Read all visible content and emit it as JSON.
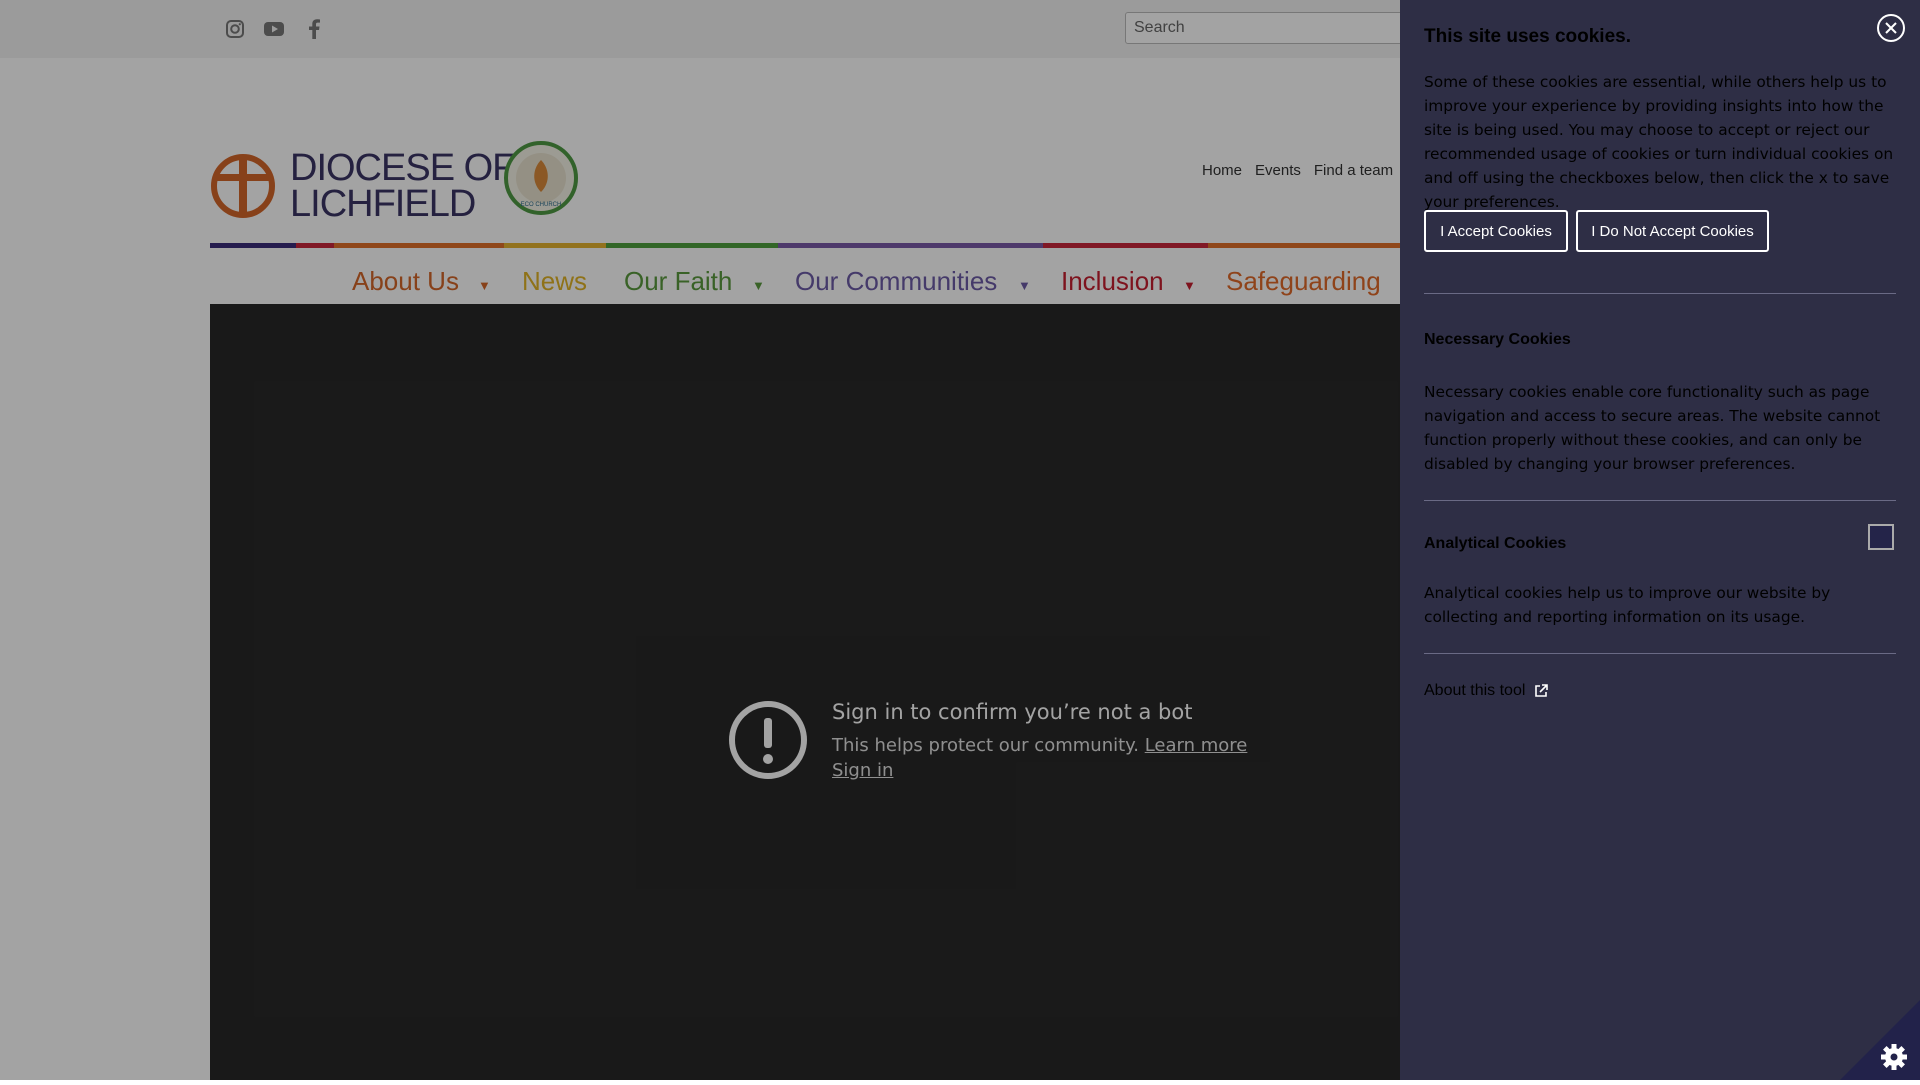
{
  "topbar": {
    "social_icons": [
      "instagram-icon",
      "youtube-icon",
      "facebook-icon"
    ],
    "search_placeholder": "Search"
  },
  "logo": {
    "line1": "DIOCESE OF",
    "line2": "LICHFIELD",
    "badge": "A Rocha Eco Church Award Winner 2025"
  },
  "top_links": [
    "Home",
    "Events",
    "Find a team"
  ],
  "main_nav": [
    {
      "label": "About Us",
      "color": "#d4662a",
      "dropdown": true
    },
    {
      "label": "News",
      "color": "#e0b326",
      "dropdown": false
    },
    {
      "label": "Our Faith",
      "color": "#5a9a3e",
      "dropdown": true
    },
    {
      "label": "Our Communities",
      "color": "#6c5ba6",
      "dropdown": true
    },
    {
      "label": "Inclusion",
      "color": "#c61f2f",
      "dropdown": true
    },
    {
      "label": "Safeguarding",
      "color": "#e06a2a",
      "dropdown": false
    }
  ],
  "rainbow_colors": [
    "#3a2d7a",
    "#c8263a",
    "#e0702a",
    "#e4b230",
    "#4fa03e",
    "#7b5aa8",
    "#c8263a",
    "#e0702a"
  ],
  "video_message": {
    "title": "Sign in to confirm you’re not a bot",
    "subtitle": "This helps protect our community.",
    "learn_more": "Learn more",
    "sign_in": "Sign in"
  },
  "cookie_panel": {
    "title": "This site uses cookies.",
    "intro": "Some of these cookies are essential, while others help us to improve your experience by providing insights into how the site is being used. You may choose to accept or reject our recommended usage of cookies or turn individual cookies on and off using the checkboxes below, then click the x to save your preferences.",
    "accept_label": "I Accept Cookies",
    "reject_label": "I Do Not Accept Cookies",
    "necessary": {
      "heading": "Necessary Cookies",
      "text": "Necessary cookies enable core functionality such as page navigation and access to secure areas. The website cannot function properly without these cookies, and can only be disabled by changing your browser preferences."
    },
    "analytical": {
      "heading": "Analytical Cookies",
      "text": "Analytical cookies help us to improve our website by collecting and reporting information on its usage.",
      "checked": false
    },
    "about_tool": "About this tool"
  }
}
